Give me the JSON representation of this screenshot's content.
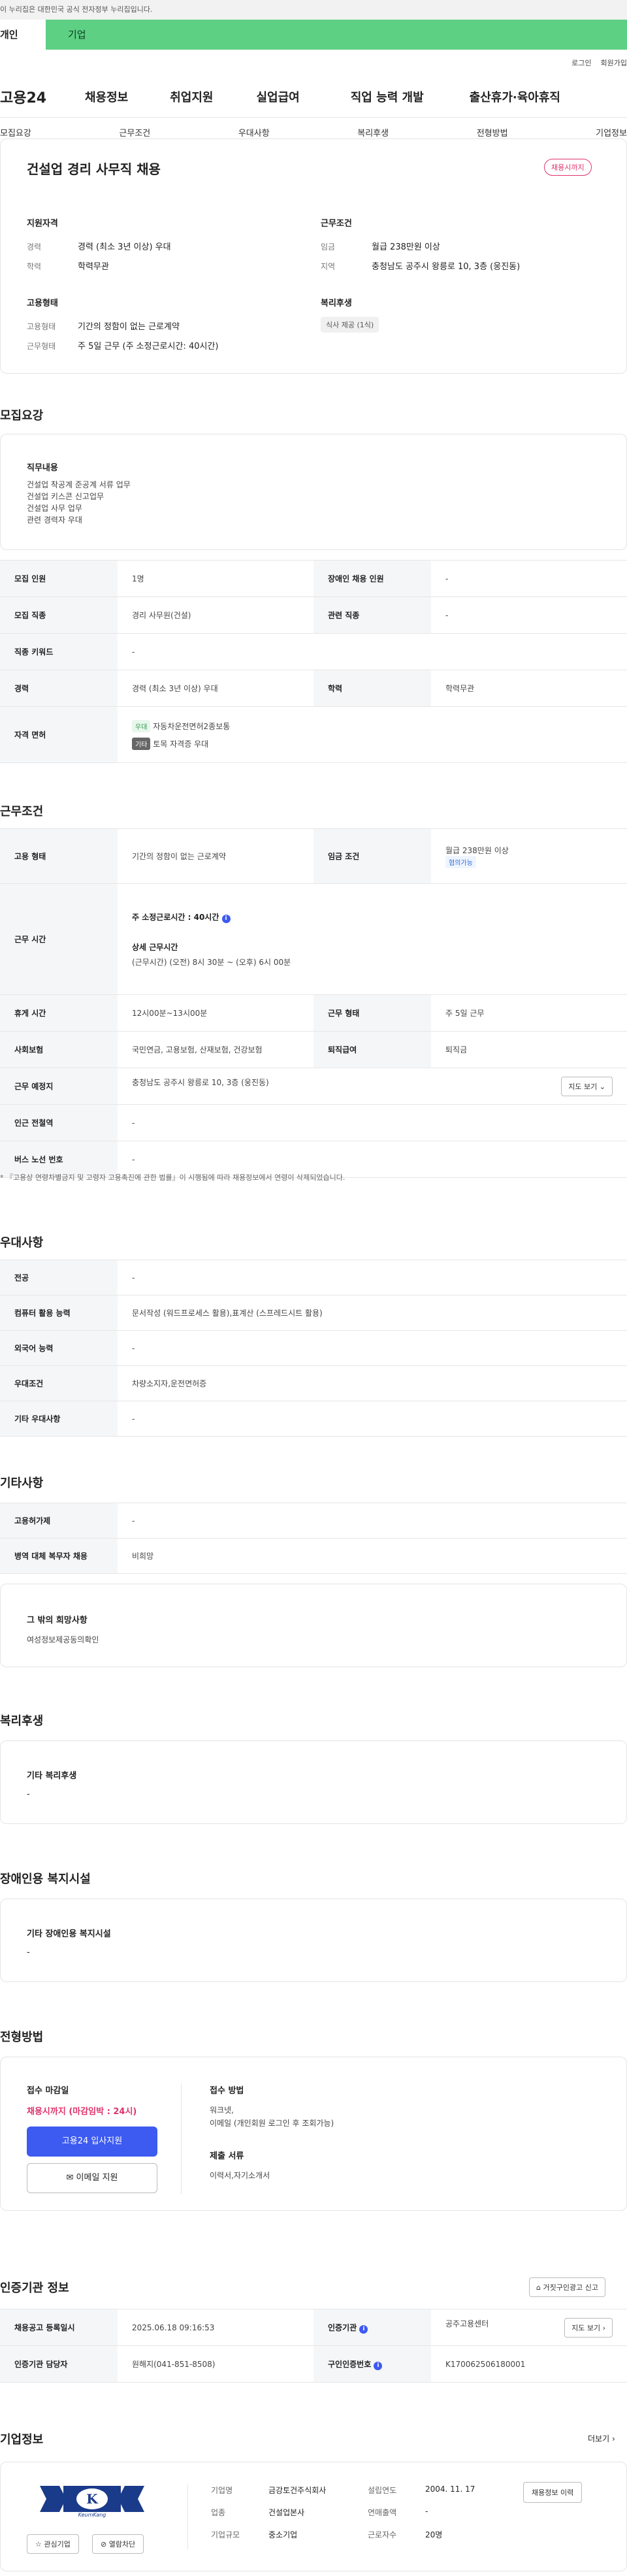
{
  "gov_banner": "이 누리집은 대한민국 공식 전자정부 누리집입니다.",
  "user_tabs": [
    "개인",
    "기업"
  ],
  "toplinks": [
    "로그인",
    "회원가입"
  ],
  "brand": "고용24",
  "gnb": [
    "채용정보",
    "취업지원",
    "실업급여",
    "직업 능력 개발",
    "출산휴가·육아휴직"
  ],
  "tabs": [
    "모집요강",
    "근무조건",
    "우대사항",
    "복리후생",
    "전형방법",
    "기업정보"
  ],
  "summary": {
    "title": "건설업 경리 사무직 채용",
    "badge": "채용시까지",
    "qual_title": "지원자격",
    "career_label": "경력",
    "career": "경력 (최소 3년 이상) 우대",
    "edu_label": "학력",
    "edu": "학력무관",
    "cond_title": "근무조건",
    "wage_label": "임금",
    "wage": "월급 238만원 이상",
    "loc_label": "지역",
    "loc": "충청남도 공주시 왕릉로 10, 3층 (웅진동)",
    "emp_title": "고용형태",
    "emptype_label": "고용형태",
    "emptype": "기간의 정함이 없는 근로계약",
    "worktype_label": "근무형태",
    "worktype": "주 5일 근무 (주 소정근로시간: 40시간)",
    "welfare_title": "복리후생",
    "welfare_chip": "식사 제공 (1식)"
  },
  "recruit": {
    "title": "모집요강",
    "duty_title": "직무내용",
    "duties": [
      "건설업 착공계 준공계 서류 업무",
      "건설업 키스콘 신고업무",
      "건설업 사무 업무",
      "관련 경력자 우대"
    ],
    "rows": {
      "count_k": "모집 인원",
      "count_v": "1명",
      "disabled_k": "장애인 채용 인원",
      "disabled_v": "-",
      "job_k": "모집 직종",
      "job_v": "경리 사무원(건설)",
      "related_k": "관련 직종",
      "related_v": "-",
      "kw_k": "직종 키워드",
      "kw_v": "-",
      "career_k": "경력",
      "career_v": "경력 (최소 3년 이상) 우대",
      "edu_k": "학력",
      "edu_v": "학력무관",
      "license_k": "자격 면허",
      "lic1_chip": "우대",
      "lic1": "자동차운전면허2종보통",
      "lic2_chip": "기타",
      "lic2": "토목 자격증 우대"
    }
  },
  "work": {
    "title": "근무조건",
    "emptype_k": "고용 형태",
    "emptype_v": "기간의 정함이 없는 근로계약",
    "wage_k": "임금 조건",
    "wage_v": "월급 238만원 이상",
    "wage_chip": "협의가능",
    "hours_k": "근무 시간",
    "hours_weekly": "주 소정근로시간 : 40시간",
    "hours_detail_t": "상세 근무시간",
    "hours_detail": "(근무시간) (오전) 8시 30분 ~ (오후) 6시 00분",
    "break_k": "휴게 시간",
    "break_v": "12시00분~13시00분",
    "wform_k": "근무 형태",
    "wform_v": "주 5일 근무",
    "ins_k": "사회보험",
    "ins_v": "국민연금, 고용보험, 산재보험, 건강보험",
    "sev_k": "퇴직급여",
    "sev_v": "퇴직금",
    "place_k": "근무 예정지",
    "place_v": "충청남도 공주시 왕릉로 10, 3층 (웅진동)",
    "map_btn": "지도 보기",
    "subway_k": "인근 전철역",
    "subway_v": "-",
    "bus_k": "버스 노선 번호",
    "bus_v": "-",
    "note": "* 『고용상 연령차별금지 및 고령자 고용촉진에 관한 법률』이 시행됨에 따라 채용정보에서 연령이 삭제되었습니다."
  },
  "pref": {
    "title": "우대사항",
    "major_k": "전공",
    "major_v": "-",
    "pc_k": "컴퓨터 활용 능력",
    "pc_v": "문서작성 (워드프로세스 활용),표계산 (스프레드시트 활용)",
    "lang_k": "외국어 능력",
    "lang_v": "-",
    "cond_k": "우대조건",
    "cond_v": "차량소지자,운전면허증",
    "etc_k": "기타 우대사항",
    "etc_v": "-"
  },
  "etc": {
    "title": "기타사항",
    "ins_k": "고용허가제",
    "ins_v": "-",
    "mil_k": "병역 대체 복무자 채용",
    "mil_v": "비희망",
    "wish_t": "그 밖의 희망사항",
    "wish_v": "여성정보제공동의확인"
  },
  "welfare": {
    "title": "복리후생",
    "sub": "기타 복리후생",
    "val": "-"
  },
  "disab": {
    "title": "장애인용 복지시설",
    "sub": "기타 장애인용 복지시설",
    "val": "-"
  },
  "process": {
    "title": "전형방법",
    "deadline_t": "접수 마감일",
    "deadline_v": "채용시까지 (마감임박 : 24시)",
    "apply_btn": "고용24 입사지원",
    "email_btn": "이메일 지원",
    "method_t": "접수 방법",
    "method_v1": "워크넷,",
    "method_v2": "이메일 (개인회원 로그인 후 조회가능)",
    "docs_t": "제출 서류",
    "docs_v": "이력서,자기소개서"
  },
  "auth": {
    "title": "인증기관 정보",
    "report_btn": "거짓구인광고 신고",
    "reg_k": "채용공고 등록일시",
    "reg_v": "2025.06.18 09:16:53",
    "org_k": "인증기관",
    "org_v": "공주고용센터",
    "map_btn": "지도 보기",
    "mgr_k": "인증기관 담당자",
    "mgr_v": "원해지(041-851-8508)",
    "num_k": "구인인증번호",
    "num_v": "K170062506180001"
  },
  "company": {
    "title": "기업정보",
    "more": "더보기",
    "logo_text": "KeumKang",
    "name_k": "기업명",
    "name_v": "금강토건주식회사",
    "est_k": "설립연도",
    "est_v": "2004. 11. 17",
    "ind_k": "업종",
    "ind_v": "건설업본사",
    "sales_k": "연매출액",
    "sales_v": "-",
    "size_k": "기업규모",
    "size_v": "중소기업",
    "emp_k": "근로자수",
    "emp_v": "20명",
    "jobs_btn": "채용정보 이력",
    "fav_btn": "관심기업",
    "block_btn": "열람차단"
  },
  "colors": {
    "accent": "#3d5af1",
    "pink": "#e0336a",
    "green": "#5ed084"
  }
}
